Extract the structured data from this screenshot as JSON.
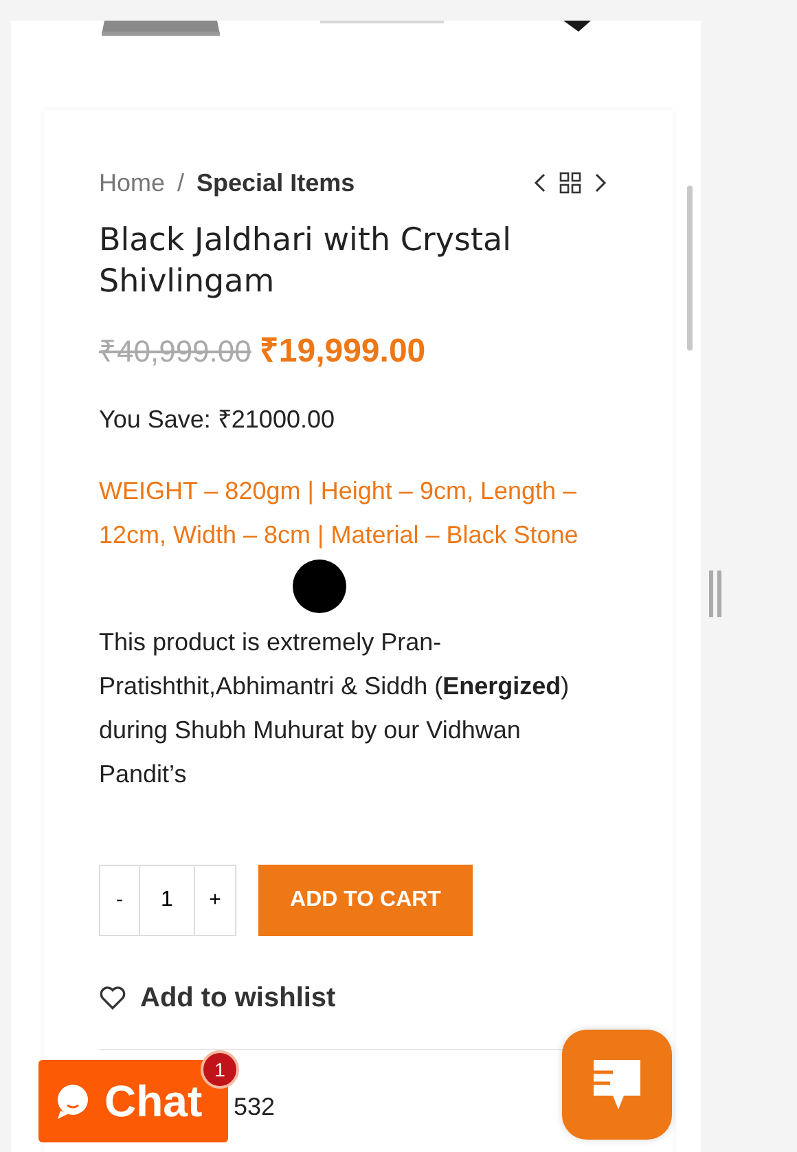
{
  "breadcrumb": {
    "home": "Home",
    "separator": "/",
    "current": "Special Items"
  },
  "title": "Black Jaldhari with Crystal Shivlingam",
  "price": {
    "old": "₹40,999.00",
    "new": "₹19,999.00"
  },
  "savings": "You Save: ₹21000.00",
  "specs": "WEIGHT – 820gm | Height – 9cm, Length – 12cm, Width – 8cm | Material – Black Stone",
  "description": "This product is extremely Pran-Pratishthit,Abhimantri & Siddh (**Energized**) during Shubh Muhurat by our Vidhwan Pandit’s",
  "quantity": {
    "minus": "-",
    "value": "1",
    "plus": "+"
  },
  "add_to_cart": "ADD TO CART",
  "wishlist": "Add to wishlist",
  "sku_fragment": "532",
  "chat": {
    "label": "Chat",
    "badge": "1"
  }
}
